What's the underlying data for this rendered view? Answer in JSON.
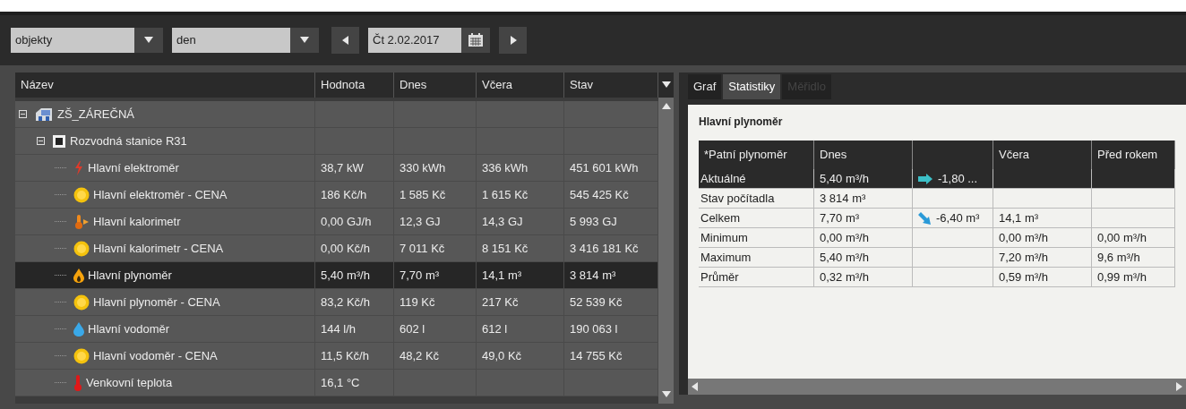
{
  "toolbar": {
    "object_select": "objekty",
    "period_select": "den",
    "date": "Čt 2.02.2017"
  },
  "tree_table": {
    "columns": [
      "Název",
      "Hodnota",
      "Dnes",
      "Včera",
      "Stav"
    ],
    "rows": [
      {
        "name": "ZŠ_ZÁREČNÁ",
        "kind": "building",
        "expanded": true,
        "selected": false,
        "children": [
          {
            "name": "Rozvodná stanice R31",
            "kind": "station",
            "expanded": true,
            "selected": false,
            "children": [
              {
                "name": "Hlavní elektroměr",
                "kind": "electricity",
                "selected": false,
                "cells": [
                  "38,7 kW",
                  "330 kWh",
                  "336 kWh",
                  "451 601 kWh"
                ]
              },
              {
                "name": "Hlavní elektroměr - CENA",
                "kind": "price",
                "selected": false,
                "cells": [
                  "186 Kč/h",
                  "1 585 Kč",
                  "1 615 Kč",
                  "545 425 Kč"
                ]
              },
              {
                "name": "Hlavní kalorimetr",
                "kind": "heat",
                "selected": false,
                "cells": [
                  "0,00 GJ/h",
                  "12,3 GJ",
                  "14,3 GJ",
                  "5 993 GJ"
                ]
              },
              {
                "name": "Hlavní kalorimetr - CENA",
                "kind": "price",
                "selected": false,
                "cells": [
                  "0,00 Kč/h",
                  "7 011 Kč",
                  "8 151 Kč",
                  "3 416 181 Kč"
                ]
              },
              {
                "name": "Hlavní plynoměr",
                "kind": "gas",
                "selected": true,
                "cells": [
                  "5,40 m³/h",
                  "7,70 m³",
                  "14,1 m³",
                  "3 814 m³"
                ]
              },
              {
                "name": "Hlavní plynoměr - CENA",
                "kind": "price",
                "selected": false,
                "cells": [
                  "83,2 Kč/h",
                  "119 Kč",
                  "217 Kč",
                  "52 539 Kč"
                ]
              },
              {
                "name": "Hlavní vodoměr",
                "kind": "water",
                "selected": false,
                "cells": [
                  "144 l/h",
                  "602 l",
                  "612 l",
                  "190 063 l"
                ]
              },
              {
                "name": "Hlavní vodoměr - CENA",
                "kind": "price",
                "selected": false,
                "cells": [
                  "11,5 Kč/h",
                  "48,2 Kč",
                  "49,0 Kč",
                  "14 755 Kč"
                ]
              },
              {
                "name": "Venkovní teplota",
                "kind": "temperature",
                "selected": false,
                "cells": [
                  "16,1 °C"
                ]
              }
            ]
          }
        ]
      }
    ]
  },
  "detail": {
    "tabs": [
      {
        "label": "Graf",
        "selected": false,
        "disabled": false
      },
      {
        "label": "Statistiky",
        "selected": true,
        "disabled": false
      },
      {
        "label": "Měřidlo",
        "selected": false,
        "disabled": true
      }
    ],
    "title": "Hlavní plynoměr",
    "stats_table": {
      "columns": [
        "*Patní plynoměr",
        "Dnes",
        "",
        "Včera",
        "Před rokem"
      ],
      "rows": [
        {
          "kind": "flat",
          "selected": true,
          "cells": [
            "Aktuálné",
            "5,40 m³/h",
            "-1,80 ...",
            "",
            ""
          ]
        },
        {
          "kind": "plain",
          "selected": false,
          "cells": [
            "Stav počítadla",
            "3 814 m³",
            "",
            "",
            ""
          ]
        },
        {
          "kind": "falling",
          "selected": false,
          "cells": [
            "Celkem",
            "7,70 m³",
            "-6,40 m³",
            "14,1 m³",
            ""
          ]
        },
        {
          "kind": "plain",
          "selected": false,
          "cells": [
            "Minimum",
            "0,00 m³/h",
            "",
            "0,00 m³/h",
            "0,00 m³/h"
          ]
        },
        {
          "kind": "plain",
          "selected": false,
          "cells": [
            "Maximum",
            "5,40 m³/h",
            "",
            "7,20 m³/h",
            "9,6 m³/h"
          ]
        },
        {
          "kind": "plain",
          "selected": false,
          "cells": [
            "Průměr",
            "0,32 m³/h",
            "",
            "0,59 m³/h",
            "0,99 m³/h"
          ]
        }
      ]
    }
  }
}
